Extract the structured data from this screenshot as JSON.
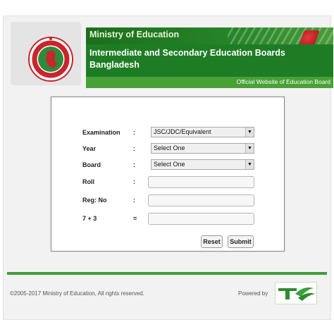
{
  "header": {
    "ministry": "Ministry of Education",
    "boards_line1": "Intermediate and Secondary Education Boards",
    "boards_line2": "Bangladesh",
    "official": "Official Website of Education Board"
  },
  "form": {
    "fields": [
      {
        "label": "Examination",
        "colon": ":",
        "value": "JSC/JDC/Equivalent"
      },
      {
        "label": "Year",
        "colon": ":",
        "value": "Select One"
      },
      {
        "label": "Board",
        "colon": ":",
        "value": "Select One"
      },
      {
        "label": "Roll",
        "colon": ":"
      },
      {
        "label": "Reg: No",
        "colon": ":"
      },
      {
        "label": "7 + 3",
        "colon": "="
      }
    ],
    "reset_label": "Reset",
    "submit_label": "Submit"
  },
  "footer": {
    "copyright": "©2005-2017 Ministry of Education, All rights reserved.",
    "powered_by": "Powered by"
  },
  "colors": {
    "brand_green": "#1e7d24",
    "accent_light_green": "#47a137",
    "flag_red": "#e8363a"
  },
  "icons": {
    "seal": "government-seal-icon",
    "select_arrow": "chevron-down-icon",
    "teletalk": "teletalk-logo"
  }
}
